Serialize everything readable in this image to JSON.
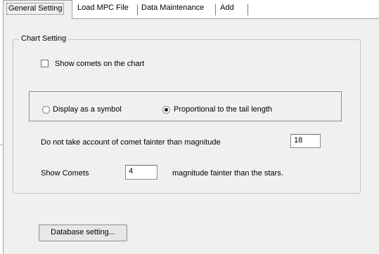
{
  "tabs": [
    {
      "label": "General Setting"
    },
    {
      "label": "Load MPC File"
    },
    {
      "label": "Data Maintenance"
    },
    {
      "label": "Add"
    }
  ],
  "chart_setting": {
    "title": "Chart Setting",
    "show_comets_label": "Show comets on the chart",
    "show_comets_checked": false,
    "radio_symbol_label": "Display as a symbol",
    "radio_proportional_label": "Proportional to the tail length",
    "selected_display_mode": "Proportional to the tail length",
    "fainter_label": "Do not take account of comet fainter than magnitude",
    "fainter_value": "18",
    "show_comets_mag_label": "Show Comets",
    "show_comets_mag_value": "4",
    "mag_suffix_label": "magnitude fainter than the stars."
  },
  "database_button_label": "Database setting..."
}
